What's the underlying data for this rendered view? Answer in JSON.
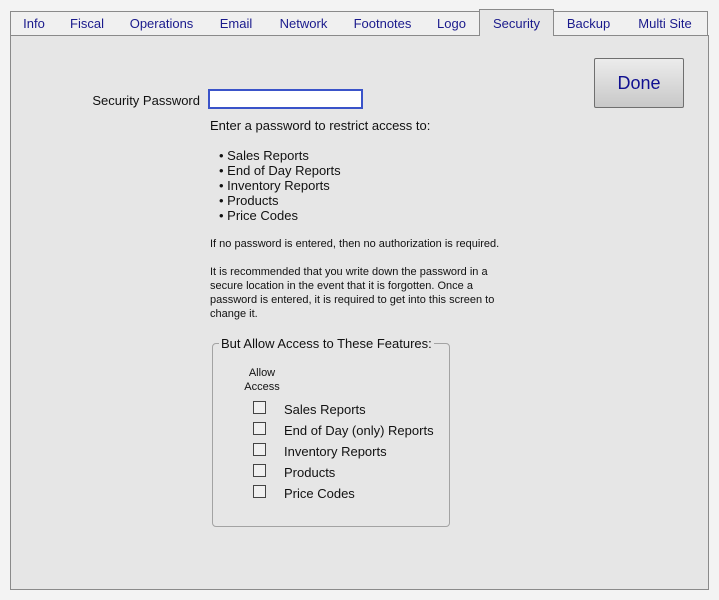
{
  "tabs": [
    {
      "label": "Info"
    },
    {
      "label": "Fiscal"
    },
    {
      "label": "Operations"
    },
    {
      "label": "Email"
    },
    {
      "label": "Network"
    },
    {
      "label": "Footnotes"
    },
    {
      "label": "Logo"
    },
    {
      "label": "Security"
    },
    {
      "label": "Backup"
    },
    {
      "label": "Multi Site"
    }
  ],
  "active_tab": "Security",
  "done_label": "Done",
  "security": {
    "password_label": "Security Password",
    "password_value": "",
    "intro": "Enter a password to restrict access to:",
    "bullets": [
      "• Sales Reports",
      "• End of Day Reports",
      "• Inventory Reports",
      "• Products",
      "• Price Codes"
    ],
    "note_no_password": "If no password is entered, then no authorization is required.",
    "recommendation": [
      "It is recommended that you write down the password in a",
      "secure location in the event that it is forgotten. Once a",
      "password is entered, it is required to get into this screen to",
      "change it."
    ]
  },
  "features": {
    "legend": "But Allow Access to These Features:",
    "column_header": [
      "Allow",
      "Access"
    ],
    "items": [
      {
        "label": "Sales Reports",
        "checked": false
      },
      {
        "label": "End of Day (only) Reports",
        "checked": false
      },
      {
        "label": "Inventory Reports",
        "checked": false
      },
      {
        "label": "Products",
        "checked": false
      },
      {
        "label": "Price Codes",
        "checked": false
      }
    ]
  },
  "colors": {
    "tab_text": "#1a1a8c",
    "panel_bg": "#e6e6e6",
    "input_border": "#3a53c9",
    "done_text": "#101090"
  }
}
